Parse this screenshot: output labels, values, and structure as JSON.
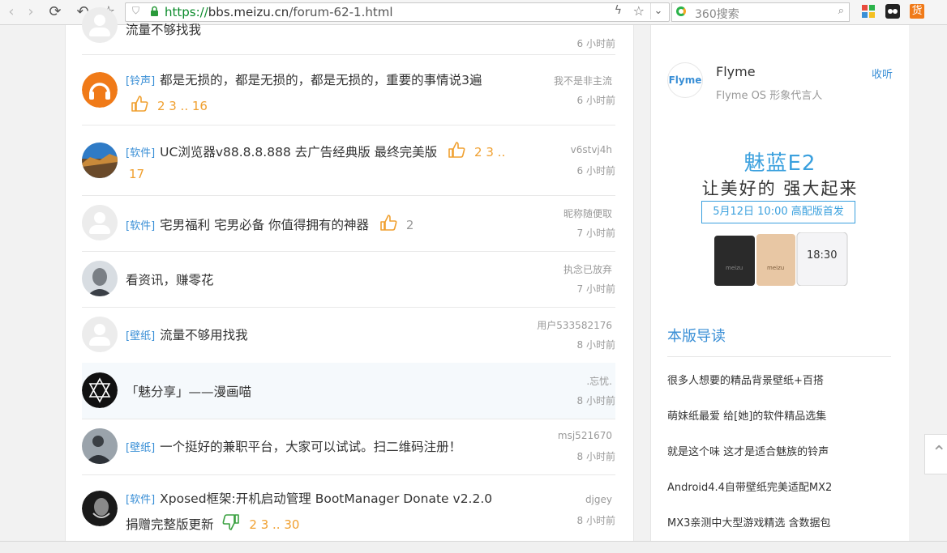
{
  "browser": {
    "url_scheme": "https://",
    "url_host": "bbs.meizu.cn",
    "url_path": "/forum-62-1.html",
    "search_placeholder": "360搜索",
    "ext_icon_label": "货"
  },
  "threads": [
    {
      "tag": "",
      "title": "流量不够找我",
      "author": "",
      "time": "6 小时前",
      "avatar": "blank"
    },
    {
      "tag": "[铃声]",
      "title": "都是无损的，都是无损的，都是无损的，重要的事情说3遍",
      "pages": "2  3 .. 16",
      "thumb": "up",
      "author": "我不是非主流",
      "time": "6 小时前",
      "avatar": "headphone"
    },
    {
      "tag": "[软件]",
      "title": "UC浏览器v88.8.8.888 去广告经典版 最终完美版",
      "pages": "2  3 ..",
      "pages2": "17",
      "thumb": "up",
      "author": "v6stvj4h",
      "time": "6 小时前",
      "avatar": "wall"
    },
    {
      "tag": "[软件]",
      "title": "宅男福利 宅男必备 你值得拥有的神器",
      "pages": "2",
      "thumb": "up",
      "author": "昵称随便取",
      "time": "7 小时前",
      "avatar": "blank"
    },
    {
      "tag": "",
      "title": "看资讯，赚零花",
      "author": "执念已放弃",
      "time": "7 小时前",
      "avatar": "face"
    },
    {
      "tag": "[壁纸]",
      "title": "流量不够用找我",
      "author": "用户533582176",
      "time": "8 小时前",
      "avatar": "blank"
    },
    {
      "tag": "",
      "title": "「魅分享」——漫画喵",
      "author": ".忘忧.",
      "time": "8 小时前",
      "avatar": "star"
    },
    {
      "tag": "[壁纸]",
      "title": "一个挺好的兼职平台，大家可以试试。扫二维码注册！",
      "author": "msj521670",
      "time": "8 小时前",
      "avatar": "person"
    },
    {
      "tag": "[软件]",
      "title": "Xposed框架:开机启动管理 BootManager Donate v2.2.0",
      "title2": "捐赠完整版更新",
      "pages": "2  3 .. 30",
      "thumb": "down",
      "author": "djgey",
      "time": "8 小时前",
      "avatar": "dark"
    }
  ],
  "sidebar": {
    "flyme_logo": "Flyme",
    "flyme_name": "Flyme",
    "flyme_desc": "Flyme OS 形象代言人",
    "follow_label": "收听",
    "ad_title": "魅蓝E2",
    "ad_sub": "让美好的 强大起来",
    "ad_date": "5月12日 10:00  高配版首发",
    "phone_time": "18:30",
    "phone_brand": "meizu",
    "section_title": "本版导读",
    "links": [
      "很多人想要的精品背景壁纸+百搭",
      "萌妹纸最爱 给[她]的软件精品选集",
      "就是这个味 这才是适合魅族的铃声",
      "Android4.4自带壁纸完美适配MX2",
      "MX3亲测中大型游戏精选 含数据包"
    ]
  },
  "colors": {
    "accent": "#3a8fd6",
    "orange": "#f0a030",
    "green_thumb": "#3aa040"
  }
}
